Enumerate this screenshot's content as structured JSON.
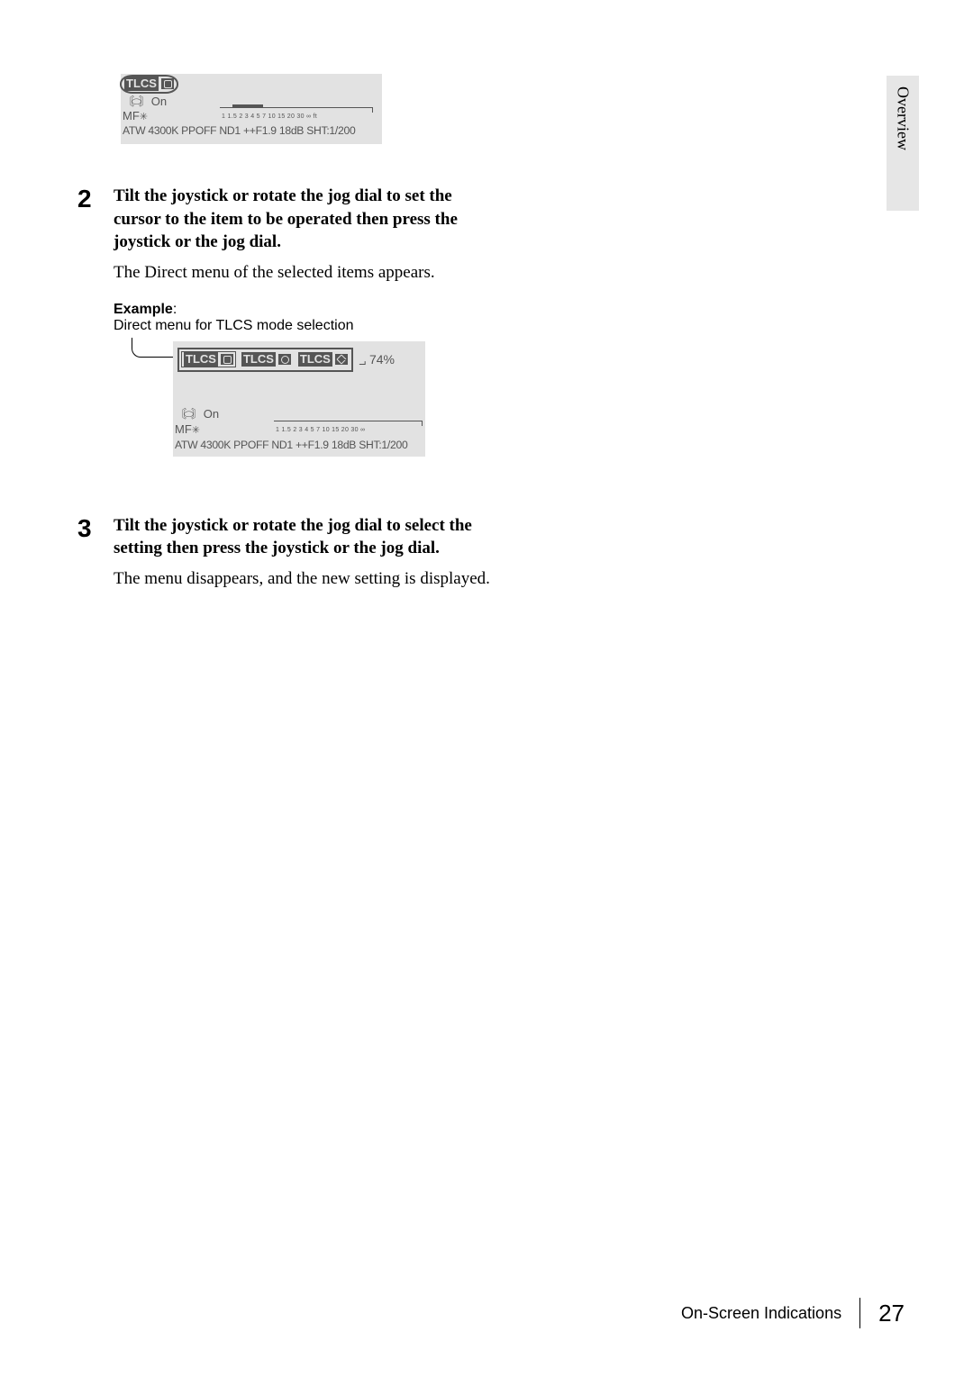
{
  "sideTab": "Overview",
  "diagram1": {
    "tlcs": "TLCS",
    "steadyOn": "On",
    "mf": "MF",
    "mfSnow": "✳",
    "steady": "〘⬭〙",
    "scaleTicks": "1  1.5 2   3  4 5   7  10  15 20  30    ∞  ft",
    "bottom": "ATW 4300K PPOFF ND1 ++F1.9  18dB SHT:1/200"
  },
  "step2": {
    "num": "2",
    "title": "Tilt the joystick or rotate the jog dial to set the cursor to the item to be operated then press the joystick or the jog dial.",
    "desc": "The Direct menu of the selected items appears.",
    "exampleLabel": "Example",
    "exampleColon": ":",
    "exampleText": "Direct menu for TLCS mode selection"
  },
  "diagram2": {
    "tlcs": "TLCS",
    "percent": "74%",
    "bracketL": "⌐",
    "bracketR": "⌐",
    "steadyOn": "On",
    "mf": "MF",
    "mfSnow": "✳",
    "steady": "〘⬭〙",
    "scaleTicks": "1  1.5 2   3  4 5   7  10  15 20  30    ∞",
    "bottom": "ATW 4300K PPOFF ND1 ++F1.9  18dB SHT:1/200"
  },
  "step3": {
    "num": "3",
    "title": "Tilt the joystick or rotate the jog dial to select the setting then press the joystick or the jog dial.",
    "desc": "The menu disappears, and the new setting is displayed."
  },
  "footer": {
    "title": "On-Screen Indications",
    "page": "27"
  }
}
